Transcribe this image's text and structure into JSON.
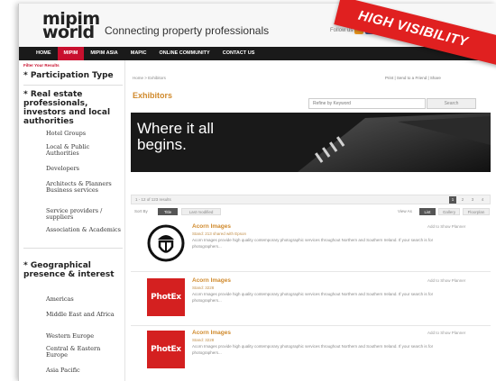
{
  "header": {
    "logo_line1": "mipim",
    "logo_line2": "world",
    "tagline": "Connecting property professionals",
    "follow_label": "Follow us",
    "banner": "HIGH VISIBILITY"
  },
  "nav": [
    {
      "label": "HOME",
      "active": false
    },
    {
      "label": "MIPIM",
      "active": true
    },
    {
      "label": "MIPIM ASIA",
      "active": false
    },
    {
      "label": "MAPIC",
      "active": false
    },
    {
      "label": "ONLINE COMMUNITY",
      "active": false
    },
    {
      "label": "CONTACT US",
      "active": false
    }
  ],
  "sidebar": {
    "filter_title": "Filter Your Results",
    "participation": "* Participation Type",
    "real_estate": "* Real estate professionals, investors and local authorities",
    "real_estate_items": [
      "Hotel Groups",
      "Local & Public Authorities",
      "Developers",
      "Architects & Planners Business services",
      "Service providers / suppliers",
      "Association & Academics"
    ],
    "geo": "* Geographical presence & interest",
    "geo_items": [
      "Americas",
      "Middle East and Africa",
      "Western Europe",
      "Central & Eastern Europe",
      "Asia Pacific"
    ]
  },
  "main": {
    "breadcrumb": "Home  >  Exhibitors",
    "tools": "Print  |  Send to a Friend  |  Share",
    "title": "Exhibitors",
    "search_placeholder": "Refine by Keyword",
    "search_button": "Search",
    "hero_line1": "Where it all",
    "hero_line2": "begins.",
    "count": "1 - 12 of 123 results",
    "pages": [
      "1",
      "2",
      "3",
      "4"
    ],
    "current_page": "1",
    "sort_label": "Sort By",
    "sort_options": [
      "Title",
      "Last modified"
    ],
    "view_label": "View As",
    "view_options": [
      "List",
      "Gallery",
      "Floorplan"
    ]
  },
  "results": [
    {
      "name": "Acorn Images",
      "stand": "Stand: 213 shared with Epson",
      "desc": "Acorn Images provide high quality contemporary photographic services throughout Northern and Southern Ireland. If your search is for photographers...",
      "planner": "Add to Show Planner",
      "logo": "acorn"
    },
    {
      "name": "Acorn Images",
      "stand": "Stand: 3228",
      "desc": "Acorn Images provide high quality contemporary photographic services throughout Northern and Southern Ireland. If your search is for photographers...",
      "planner": "Add to Show Planner",
      "logo": "PhotEx"
    },
    {
      "name": "Acorn Images",
      "stand": "Stand: 3228",
      "desc": "Acorn Images provide high quality contemporary photographic services throughout Northern and Southern Ireland. If your search is for photographers...",
      "planner": "Add to Show Planner",
      "logo": "PhotEx"
    }
  ],
  "colors": {
    "accent": "#c8102e",
    "title": "#d08a2c",
    "nav_bg": "#1a1a1a",
    "banner": "#e02020"
  }
}
